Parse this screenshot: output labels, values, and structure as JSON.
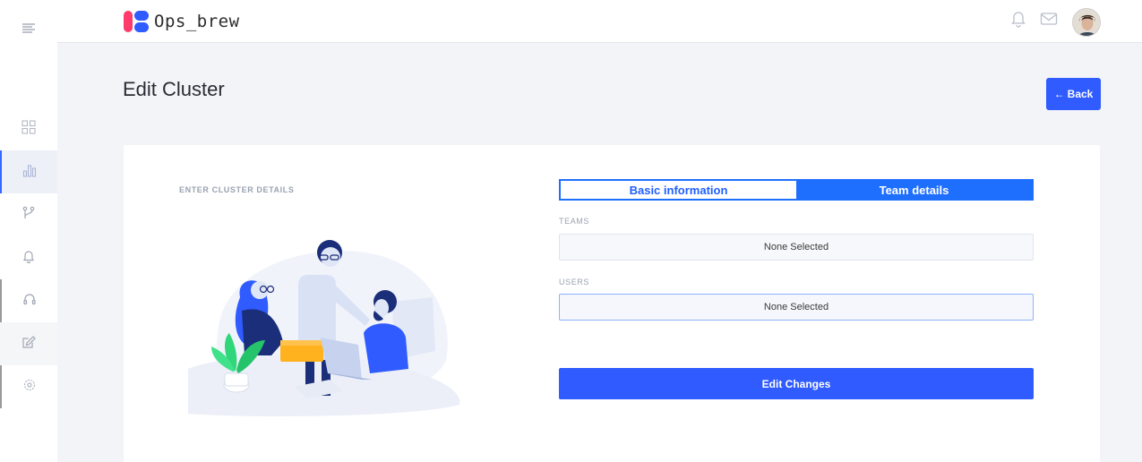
{
  "app": {
    "name": "Ops_brew",
    "colors": {
      "primary": "#2f5bff",
      "tab_active": "#1f6fff",
      "logo_pink": "#ff3b6b"
    }
  },
  "sidebar": {
    "items": [
      {
        "icon": "menu-icon"
      },
      {
        "icon": "grid-icon"
      },
      {
        "icon": "bar-chart-icon"
      },
      {
        "icon": "git-branch-icon"
      },
      {
        "icon": "bell-icon"
      },
      {
        "icon": "headphones-icon"
      },
      {
        "icon": "edit-icon"
      },
      {
        "icon": "settings-icon"
      }
    ]
  },
  "header": {
    "icons": [
      "bell-icon",
      "mail-icon",
      "avatar"
    ]
  },
  "page": {
    "title": "Edit Cluster",
    "back_label": "Back"
  },
  "form": {
    "section_label": "ENTER CLUSTER DETAILS",
    "tabs": [
      {
        "label": "Basic information",
        "active": false
      },
      {
        "label": "Team details",
        "active": true
      }
    ],
    "teams": {
      "label": "TEAMS",
      "value": "None Selected"
    },
    "users": {
      "label": "USERS",
      "value": "None Selected"
    },
    "submit_label": "Edit Changes"
  }
}
